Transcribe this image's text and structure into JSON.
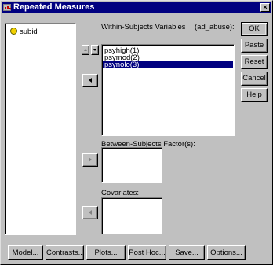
{
  "window": {
    "title": "Repeated Measures",
    "close_glyph": "×"
  },
  "source_list": {
    "items": [
      {
        "label": "subid",
        "icon": "scale-variable-icon"
      }
    ]
  },
  "within": {
    "label": "Within-Subjects Variables",
    "factor": "(ad_abuse):",
    "rows": [
      "psyhigh(1)",
      "psymod(2)",
      "psynolo(3)"
    ],
    "selected_index": 2
  },
  "between": {
    "label": "Between-Subjects Factor(s):"
  },
  "covariates": {
    "label": "Covariates:"
  },
  "side_buttons": {
    "ok": "OK",
    "paste": "Paste",
    "reset": "Reset",
    "cancel": "Cancel",
    "help": "Help"
  },
  "bottom_buttons": {
    "model": "Model...",
    "contrasts": "Contrasts...",
    "plots": "Plots...",
    "post_hoc": "Post Hoc...",
    "save": "Save...",
    "options": "Options..."
  },
  "colors": {
    "title_bar": "#000080",
    "selection": "#000080",
    "dialog_face": "#c0c0c0"
  }
}
